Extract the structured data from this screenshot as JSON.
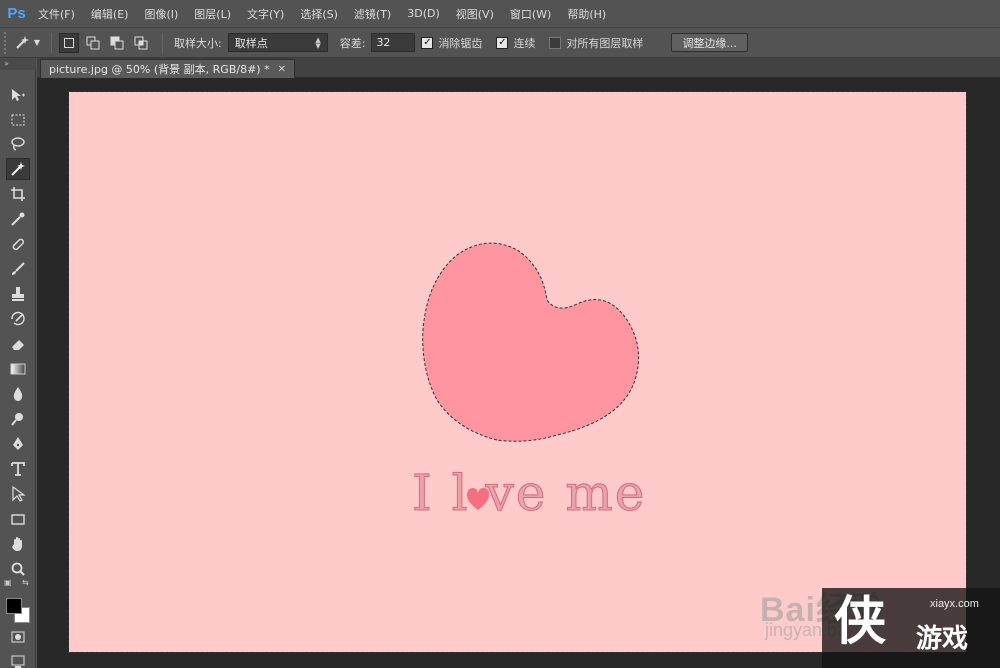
{
  "app": {
    "logo": "Ps"
  },
  "menu": [
    "文件(F)",
    "编辑(E)",
    "图像(I)",
    "图层(L)",
    "文字(Y)",
    "选择(S)",
    "滤镜(T)",
    "3D(D)",
    "视图(V)",
    "窗口(W)",
    "帮助(H)"
  ],
  "options": {
    "sample_size_label": "取样大小:",
    "sample_size_value": "取样点",
    "tolerance_label": "容差:",
    "tolerance_value": "32",
    "anti_alias_label": "消除锯齿",
    "anti_alias_checked": true,
    "contiguous_label": "连续",
    "contiguous_checked": true,
    "sample_all_layers_label": "对所有图层取样",
    "sample_all_layers_checked": false,
    "refine_edge_label": "调整边缘..."
  },
  "document": {
    "tab_title": "picture.jpg @ 50% (背景 副本, RGB/8#) *",
    "canvas_color": "#fecbca",
    "heart_color": "#fe95a0",
    "text_before": "I l",
    "text_after": "ve me"
  },
  "colors": {
    "foreground": "#000000",
    "background": "#ffffff"
  },
  "watermarks": {
    "baidu": "Bai经验",
    "url": "jingyan.ba",
    "site": "xiayx.com",
    "game": "游戏",
    "glyph": "侠"
  }
}
